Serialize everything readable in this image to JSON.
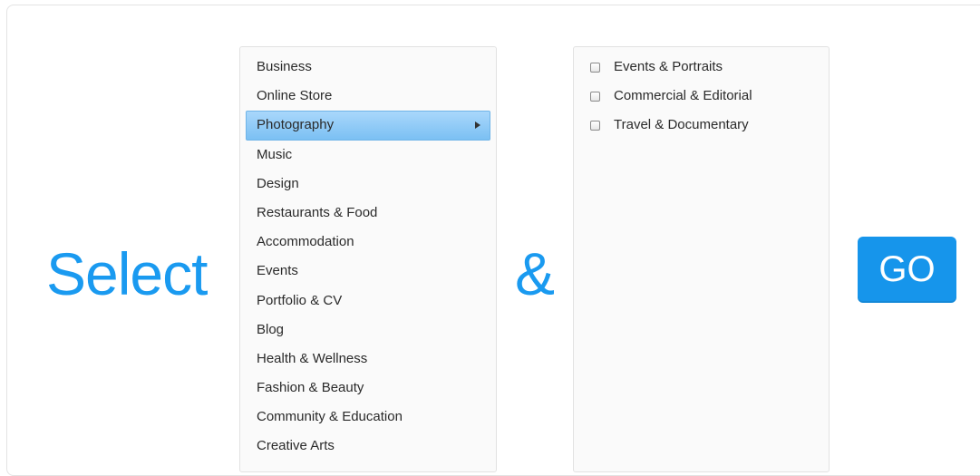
{
  "heading": {
    "select_label": "Select",
    "ampersand_label": "&",
    "accent_color": "#1a9af0"
  },
  "categories": {
    "active_index": 2,
    "items": [
      {
        "label": "Business"
      },
      {
        "label": "Online Store"
      },
      {
        "label": "Photography"
      },
      {
        "label": "Music"
      },
      {
        "label": "Design"
      },
      {
        "label": "Restaurants & Food"
      },
      {
        "label": "Accommodation"
      },
      {
        "label": "Events"
      },
      {
        "label": "Portfolio & CV"
      },
      {
        "label": "Blog"
      },
      {
        "label": "Health & Wellness"
      },
      {
        "label": "Fashion & Beauty"
      },
      {
        "label": "Community & Education"
      },
      {
        "label": "Creative Arts"
      }
    ]
  },
  "subcategories": {
    "items": [
      {
        "label": "Events & Portraits",
        "checked": false
      },
      {
        "label": "Commercial & Editorial",
        "checked": false
      },
      {
        "label": "Travel & Documentary",
        "checked": false
      }
    ]
  },
  "go_button": {
    "label": "GO",
    "color": "#1695eb"
  }
}
